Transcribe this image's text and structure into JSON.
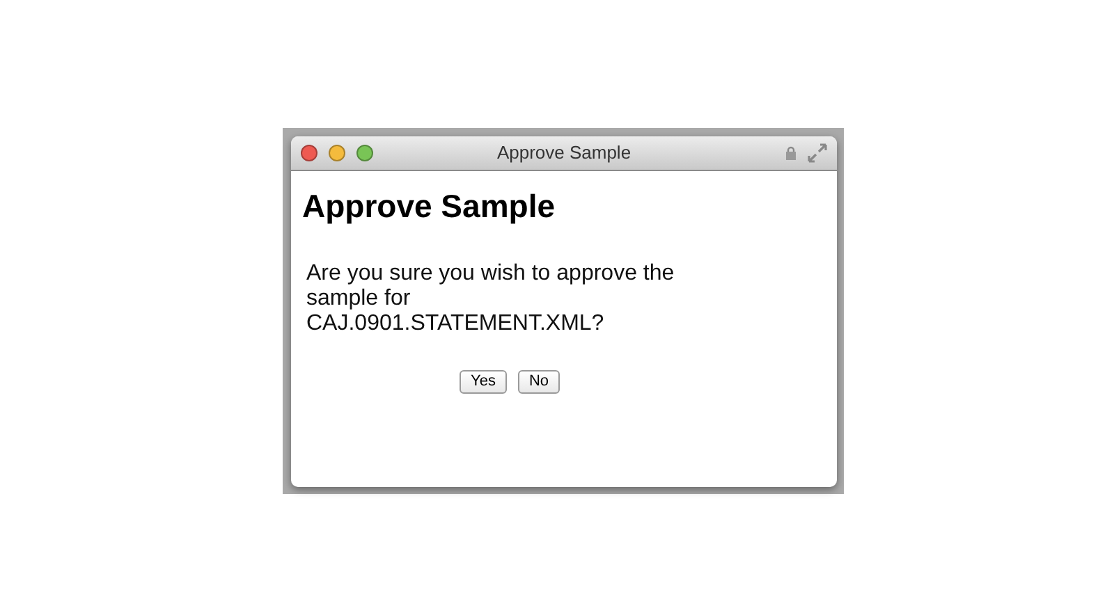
{
  "window": {
    "title": "Approve Sample"
  },
  "dialog": {
    "heading": "Approve Sample",
    "message": "Are you sure you wish to approve the sample for CAJ.0901.STATEMENT.XML?"
  },
  "buttons": [
    "Yes",
    "No"
  ]
}
